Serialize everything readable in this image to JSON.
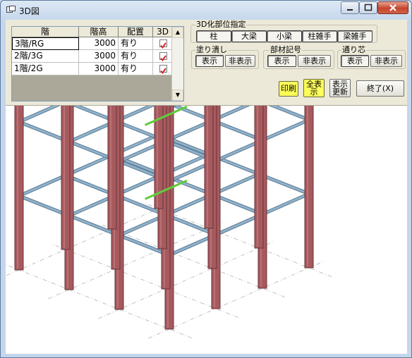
{
  "window": {
    "title": "3D図",
    "min_icon": "minimize-icon",
    "max_icon": "maximize-icon",
    "close_icon": "close-icon",
    "title_icon": "window-app-icon"
  },
  "table": {
    "headers": [
      "階",
      "階高",
      "配置",
      "3D"
    ],
    "rows": [
      {
        "floor": "3階/RG",
        "height": "3000",
        "layout": "有り",
        "show3d": true
      },
      {
        "floor": "2階/3G",
        "height": "3000",
        "layout": "有り",
        "show3d": true
      },
      {
        "floor": "1階/2G",
        "height": "3000",
        "layout": "有り",
        "show3d": true
      }
    ]
  },
  "part_select": {
    "title": "3D化部位指定",
    "buttons": [
      "柱",
      "大梁",
      "小梁",
      "柱雑手",
      "梁雑手"
    ]
  },
  "fill": {
    "title": "塗り潰し",
    "show": "表示",
    "hide": "非表示"
  },
  "member_mark": {
    "title": "部材記号",
    "show": "表示",
    "hide": "非表示"
  },
  "grid_line": {
    "title": "通り芯",
    "show": "表示",
    "hide": "非表示"
  },
  "actions": {
    "print": "印刷",
    "full_1": "全表",
    "full_2": "示",
    "refresh_1": "表示",
    "refresh_2": "更新",
    "exit": "終了(X)"
  },
  "colors": {
    "column": "#a65a5e",
    "beam": "#8fb2cc",
    "sub_beam": "#5fcd3c",
    "check_mark": "#d12828"
  }
}
